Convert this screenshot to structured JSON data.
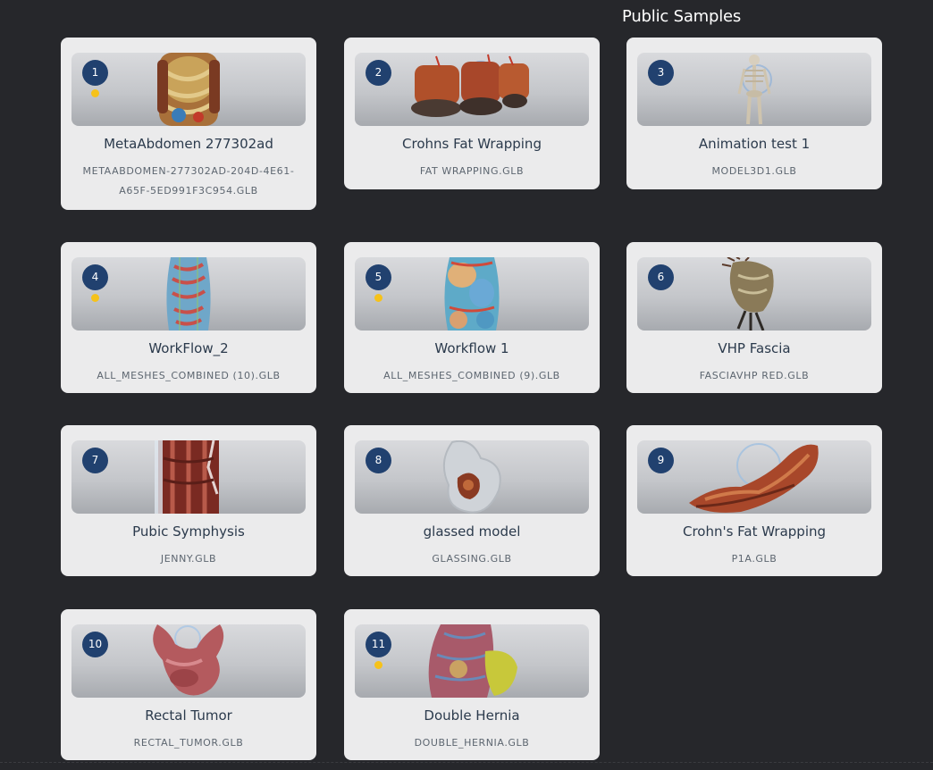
{
  "section_title": "Public Samples",
  "colors": {
    "badge": "#21416f",
    "dot": "#f6c21a",
    "card": "#ebebec",
    "background": "#26272b"
  },
  "cards": [
    {
      "number": "1",
      "title": "MetaAbdomen 277302ad",
      "file": "METAABDOMEN-277302AD-204D-4E61-A65F-5ED991F3C954.GLB",
      "has_dot": true,
      "icon": "abdomen-model-icon"
    },
    {
      "number": "2",
      "title": "Crohns Fat Wrapping",
      "file": "FAT WRAPPING.GLB",
      "has_dot": false,
      "icon": "bowel-model-icon"
    },
    {
      "number": "3",
      "title": "Animation test 1",
      "file": "MODEL3D1.GLB",
      "has_dot": false,
      "icon": "skeleton-model-icon"
    },
    {
      "number": "4",
      "title": "WorkFlow_2",
      "file": "ALL_MESHES_COMBINED (10).GLB",
      "has_dot": true,
      "icon": "torso-model-icon"
    },
    {
      "number": "5",
      "title": "Workflow 1",
      "file": "ALL_MESHES_COMBINED (9).GLB",
      "has_dot": true,
      "icon": "organs-model-icon"
    },
    {
      "number": "6",
      "title": "VHP Fascia",
      "file": "FASCIAVHP RED.GLB",
      "has_dot": false,
      "icon": "fascia-model-icon"
    },
    {
      "number": "7",
      "title": "Pubic Symphysis",
      "file": "JENNY.GLB",
      "has_dot": false,
      "icon": "muscle-model-icon"
    },
    {
      "number": "8",
      "title": "glassed model",
      "file": "GLASSING.GLB",
      "has_dot": false,
      "icon": "glass-model-icon"
    },
    {
      "number": "9",
      "title": "Crohn's Fat Wrapping",
      "file": "P1A.GLB",
      "has_dot": false,
      "icon": "intestine-model-icon"
    },
    {
      "number": "10",
      "title": "Rectal Tumor",
      "file": "RECTAL_TUMOR.GLB",
      "has_dot": false,
      "icon": "rectum-model-icon"
    },
    {
      "number": "11",
      "title": "Double Hernia",
      "file": "DOUBLE_HERNIA.GLB",
      "has_dot": true,
      "icon": "hernia-model-icon"
    }
  ]
}
